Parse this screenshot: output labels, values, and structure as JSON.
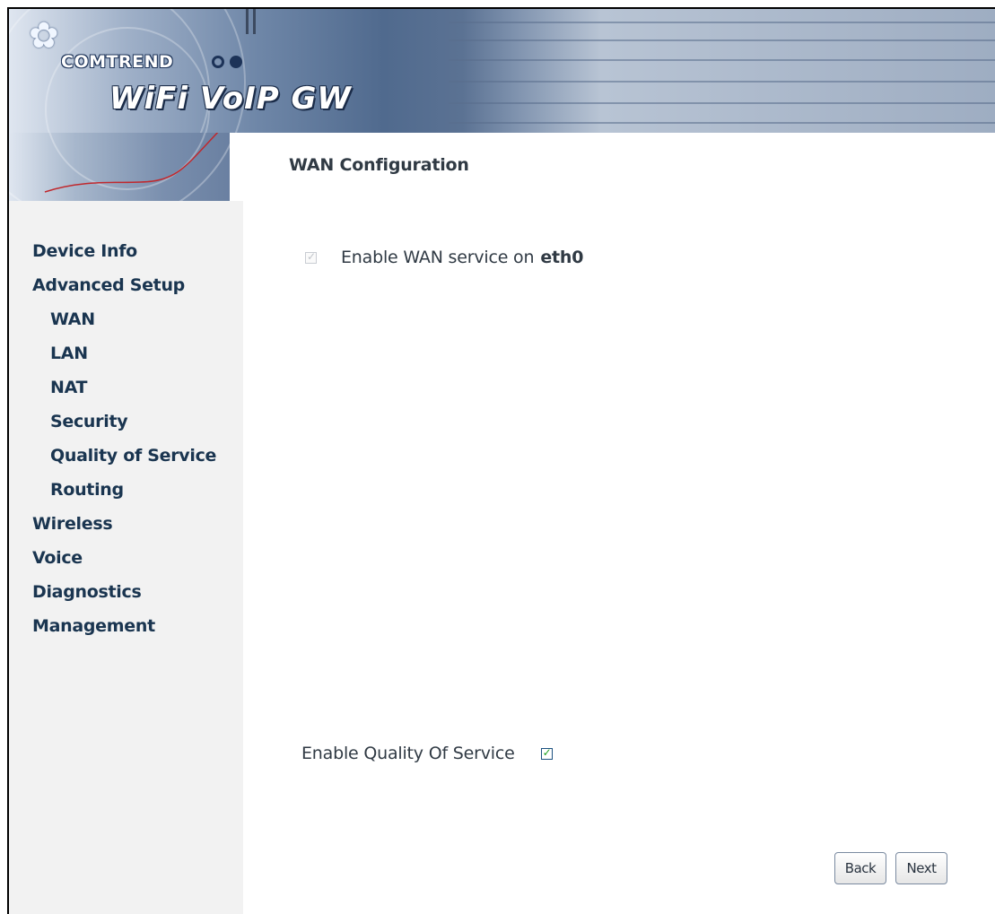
{
  "header": {
    "brand": "COMTREND",
    "product": "WiFi VoIP GW"
  },
  "sidebar": {
    "items": [
      {
        "label": "Device Info",
        "level": 0
      },
      {
        "label": "Advanced Setup",
        "level": 0
      },
      {
        "label": "WAN",
        "level": 1
      },
      {
        "label": "LAN",
        "level": 1
      },
      {
        "label": "NAT",
        "level": 1
      },
      {
        "label": "Security",
        "level": 1
      },
      {
        "label": "Quality of Service",
        "level": 1
      },
      {
        "label": "Routing",
        "level": 1
      },
      {
        "label": "Wireless",
        "level": 0
      },
      {
        "label": "Voice",
        "level": 0
      },
      {
        "label": "Diagnostics",
        "level": 0
      },
      {
        "label": "Management",
        "level": 0
      }
    ]
  },
  "main": {
    "title": "WAN Configuration",
    "wan_service": {
      "label_prefix": "Enable WAN service on",
      "interface": "eth0",
      "checked": true,
      "disabled": true
    },
    "qos": {
      "label": "Enable Quality Of Service",
      "checked": true
    },
    "buttons": {
      "back": "Back",
      "next": "Next"
    }
  }
}
